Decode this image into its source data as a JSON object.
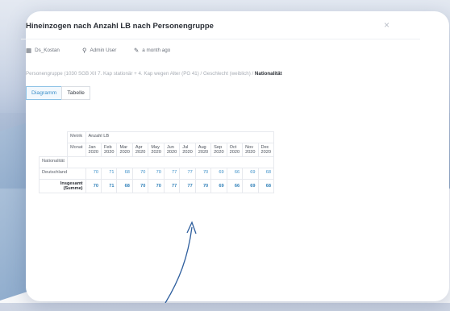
{
  "dialog": {
    "title": "Hineinzogen nach Anzahl LB nach Personengruppe",
    "close_label": "×"
  },
  "meta": {
    "source": "Ds_Kostan",
    "user": "Admin User",
    "time": "a month ago"
  },
  "breadcrumb": {
    "path": "Personengruppe (1030 SGB XII 7. Kap stationär + 4. Kap wegen Alter (PG 41) / Geschlecht (weiblich) / ",
    "current": "Nationalität"
  },
  "tabs": [
    {
      "label": "Diagramm",
      "active": true
    },
    {
      "label": "Tabelle",
      "active": false
    }
  ],
  "table": {
    "metrik_label": "Metrik",
    "metrik_value": "Anzahl LB",
    "monat_label": "Monat",
    "row_dim_label": "Nationalität",
    "months": [
      {
        "m": "Jan",
        "y": "2020"
      },
      {
        "m": "Feb",
        "y": "2020"
      },
      {
        "m": "Mar",
        "y": "2020"
      },
      {
        "m": "Apr",
        "y": "2020"
      },
      {
        "m": "May",
        "y": "2020"
      },
      {
        "m": "Jun",
        "y": "2020"
      },
      {
        "m": "Jul",
        "y": "2020"
      },
      {
        "m": "Aug",
        "y": "2020"
      },
      {
        "m": "Sep",
        "y": "2020"
      },
      {
        "m": "Oct",
        "y": "2020"
      },
      {
        "m": "Nov",
        "y": "2020"
      },
      {
        "m": "Dec",
        "y": "2020"
      }
    ],
    "rows": [
      {
        "label": "Deutschland",
        "values": [
          "70",
          "71",
          "68",
          "70",
          "70",
          "77",
          "77",
          "70",
          "69",
          "66",
          "69",
          "68"
        ]
      }
    ],
    "total": {
      "label_line1": "Insgesamt",
      "label_line2": "(Summe)",
      "values": [
        "70",
        "71",
        "68",
        "70",
        "70",
        "77",
        "77",
        "70",
        "69",
        "66",
        "69",
        "68"
      ]
    }
  },
  "colors": {
    "accent": "#3b8fc9",
    "annotation_arrow": "#2f5f9e"
  }
}
